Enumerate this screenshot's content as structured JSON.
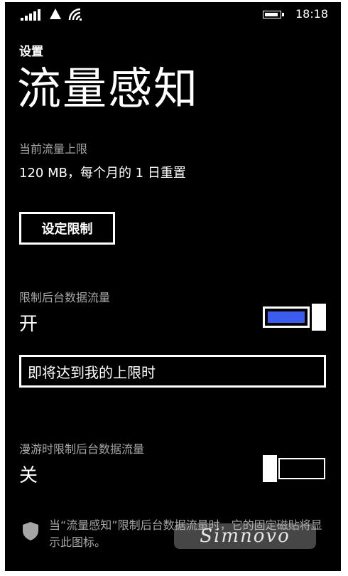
{
  "status_bar": {
    "time": "18:18",
    "icons": [
      "signal-strength-icon",
      "data-connection-icon",
      "wifi-icon",
      "battery-icon"
    ]
  },
  "app_title": "设置",
  "page_title": "流量感知",
  "limit_section": {
    "label": "当前流量上限",
    "value": "120 MB，每个月的 1 日重置",
    "button_label": "设定限制"
  },
  "background_restrict": {
    "label": "限制后台数据流量",
    "state": "开",
    "toggle_on": true,
    "select_value": "即将达到我的上限时"
  },
  "roaming_restrict": {
    "label": "漫游时限制后台数据流量",
    "state": "关",
    "toggle_on": false
  },
  "note": {
    "icon": "shield-icon",
    "text": "当“流量感知”限制后台数据流量时，它的固定磁贴将显示此图标。"
  },
  "watermark": "Simnovo",
  "colors": {
    "background": "#000000",
    "accent": "#3c5cf0",
    "foreground": "#ffffff",
    "subtle": "#a6a6a6"
  }
}
